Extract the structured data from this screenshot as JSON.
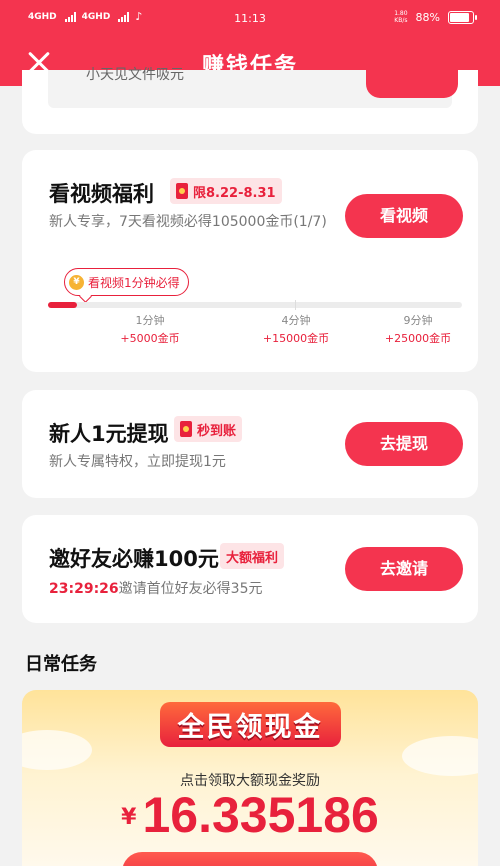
{
  "status_bar": {
    "network1": "4GHD",
    "network2": "4GHD",
    "time": "11:13",
    "speed_value": "1.80",
    "speed_unit": "KB/s",
    "battery": "88%",
    "battery_level": 0.88
  },
  "header": {
    "title": "赚钱任务",
    "close_icon": "close-icon"
  },
  "top_card": {
    "text": "小天见文件吸元",
    "button": ""
  },
  "tasks": [
    {
      "title": "看视频福利",
      "tag": "限8.22-8.31",
      "description": "新人专享，7天看视频必得105000金币(1/7)",
      "button": "看视频",
      "bubble": "看视频1分钟必得",
      "progress": 0.07,
      "milestones": [
        {
          "time": "1分钟",
          "reward": "+5000金币"
        },
        {
          "time": "4分钟",
          "reward": "+15000金币"
        },
        {
          "time": "9分钟",
          "reward": "+25000金币"
        }
      ]
    },
    {
      "title": "新人1元提现",
      "tag": "秒到账",
      "description": "新人专属特权，立即提现1元",
      "button": "去提现"
    },
    {
      "title": "邀好友必赚100元",
      "tag": "大额福利",
      "countdown": "23:29:26",
      "description": "邀请首位好友必得35元",
      "button": "去邀请"
    }
  ],
  "daily": {
    "section_title": "日常任务",
    "banner_title": "全民领现金",
    "banner_subtitle": "点击领取大额现金奖励",
    "currency": "¥",
    "amount": "16.335186"
  },
  "colors": {
    "accent": "#f4344f",
    "tag_bg": "#fde4e6"
  }
}
